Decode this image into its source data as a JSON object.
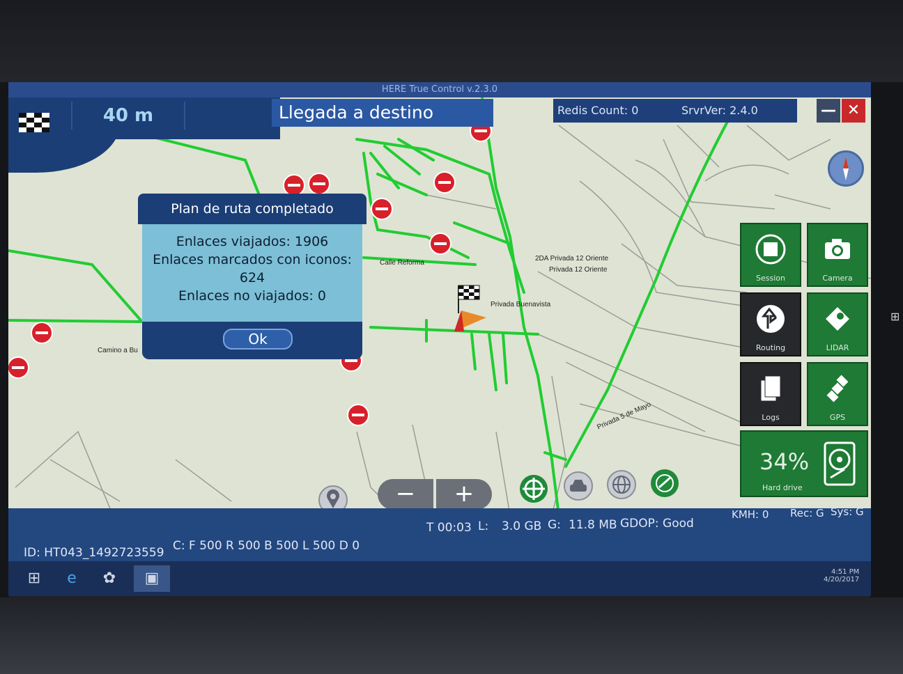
{
  "window": {
    "title": "HERE True Control v.2.3.0"
  },
  "header": {
    "distance": "40 m",
    "destination": "Llegada a destino",
    "redis_count": "Redis Count: 0",
    "server_version": "SrvrVer: 2.4.0"
  },
  "map_labels": {
    "calle_reforma": "Calle Reforma",
    "camino": "Camino a Bu",
    "privada_12_a": "2DA Privada 12 Oriente",
    "privada_12_b": "Privada 12 Oriente",
    "privada_buenavista": "Privada Buenavista",
    "privada_5_mayo": "Privada 5 de Mayo"
  },
  "dialog": {
    "title": "Plan de ruta completado",
    "line1": "Enlaces viajados: 1906",
    "line2": "Enlaces marcados con iconos:",
    "line3": "624",
    "line4": "Enlaces no viajados: 0",
    "ok_label": "Ok"
  },
  "tiles": {
    "session": "Session",
    "camera": "Camera",
    "routing": "Routing",
    "lidar": "LIDAR",
    "logs": "Logs",
    "gps": "GPS",
    "hard_drive_label": "Hard drive",
    "hard_drive_pct": "34%"
  },
  "status": {
    "time": "T 00:03",
    "l_label": "L:",
    "l_value": "3.0 GB",
    "g_label": "G:",
    "g_value": "11.8 MB",
    "gdop": "GDOP: Good",
    "kmh": "KMH: 0",
    "rec": "Rec: G",
    "sys": "Sys: G",
    "id": "ID: HT043_1492723559",
    "counts": "C: F 500 R 500 B 500 L 500 D 0"
  },
  "taskbar": {
    "time": "4:51 PM",
    "date": "4/20/2017"
  },
  "colors": {
    "panel_blue": "#1c3e76",
    "tile_green": "#1e7a35",
    "route_green": "#22cc33",
    "stop_red": "#d8202a"
  },
  "icons": [
    "checkered-flag-icon",
    "compass-icon",
    "session-stop-icon",
    "camera-icon",
    "routing-icon",
    "lidar-icon",
    "logs-icon",
    "gps-satellite-icon",
    "hard-drive-icon",
    "location-pin-icon",
    "zoom-out-icon",
    "zoom-in-icon",
    "crosshair-icon",
    "car-icon",
    "globe-icon",
    "satellite-view-icon",
    "windows-start-icon",
    "ie-icon"
  ]
}
